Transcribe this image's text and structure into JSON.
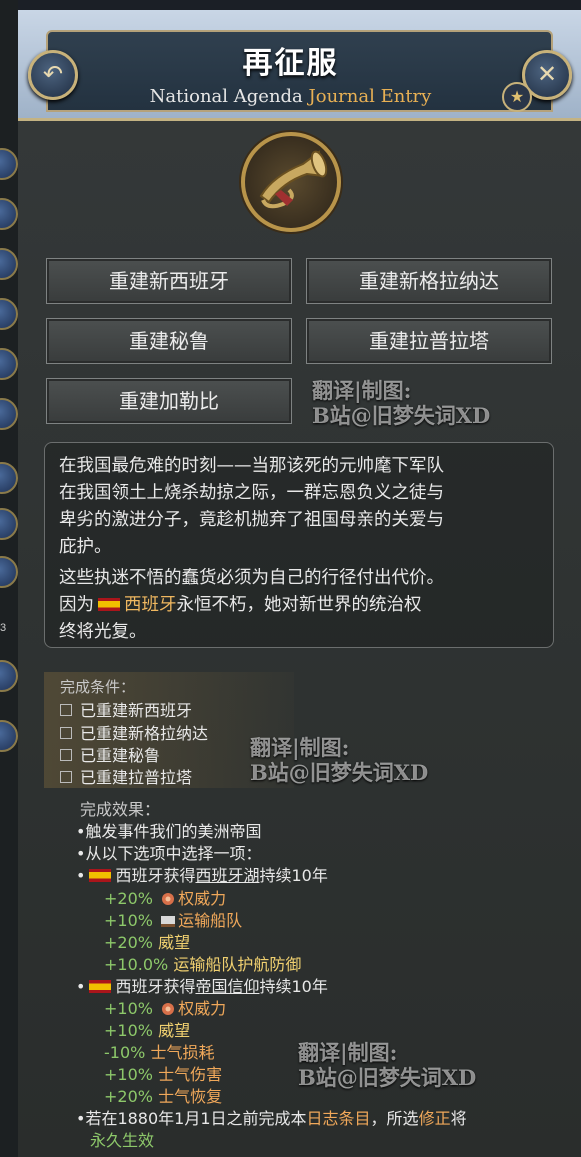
{
  "header": {
    "title": "再征服",
    "subtitle_main": "National Agenda",
    "subtitle_accent": "Journal Entry",
    "back_icon": "undo-arrow-icon",
    "close_icon": "close-icon",
    "star_icon": "star-icon"
  },
  "emblem_icon": "bugle-icon",
  "buttons": [
    "重建新西班牙",
    "重建新格拉纳达",
    "重建秘鲁",
    "重建拉普拉塔",
    "重建加勒比"
  ],
  "watermark": {
    "line1": "翻译|制图:",
    "line2": "B站@旧梦失词XD"
  },
  "description": {
    "para1_lines": [
      "在我国最危难的时刻——当那该死的元帅麾下军队",
      "在我国领土上烧杀劫掠之际，一群忘恩负义之徒与",
      "卑劣的激进分子，竟趁机抛弃了祖国母亲的关爱与",
      "庇护。"
    ],
    "para2_line1": "这些执迷不悟的蠢货必须为自己的行径付出代价。",
    "para2_line2_pre": "因为",
    "para2_country": "西班牙",
    "para2_line2_post": "永恒不朽，她对新世界的统治权",
    "para2_line3": "终将光复。"
  },
  "conditions": {
    "title": "完成条件：",
    "items": [
      "已重建新西班牙",
      "已重建新格拉纳达",
      "已重建秘鲁",
      "已重建拉普拉塔"
    ]
  },
  "effects": {
    "title": "完成效果：",
    "line1_pre": "•触发事件",
    "line1_event": "我们的美洲帝国",
    "line2": "•从以下选项中选择一项：",
    "opt1": {
      "pre": "西班牙获得",
      "modifier": "西班牙湖",
      "post": "持续10年",
      "mods": [
        {
          "value": "+20%",
          "name": "权威力",
          "icon": "authority-icon"
        },
        {
          "value": "+10%",
          "name": "运输船队",
          "icon": "convoy-icon"
        },
        {
          "value": "+20%",
          "name": "威望",
          "icon": ""
        },
        {
          "value": "+10.0%",
          "name": "运输船队护航防御",
          "icon": ""
        }
      ]
    },
    "opt2": {
      "pre": "西班牙获得",
      "modifier": "帝国信仰",
      "post": "持续10年",
      "mods": [
        {
          "value": "+10%",
          "name": "权威力",
          "icon": "authority-icon"
        },
        {
          "value": "+10%",
          "name": "威望",
          "icon": ""
        },
        {
          "value": "-10%",
          "name": "士气损耗",
          "icon": ""
        },
        {
          "value": "+10%",
          "name": "士气伤害",
          "icon": ""
        },
        {
          "value": "+20%",
          "name": "士气恢复",
          "icon": ""
        }
      ]
    },
    "final_pre": "•若在1880年1月1日之前完成本",
    "final_journal": "日志条目",
    "final_mid": "，所选",
    "final_modifier": "修正",
    "final_post": "将",
    "final_line2": "永久生效"
  },
  "left_strip_number": "3"
}
